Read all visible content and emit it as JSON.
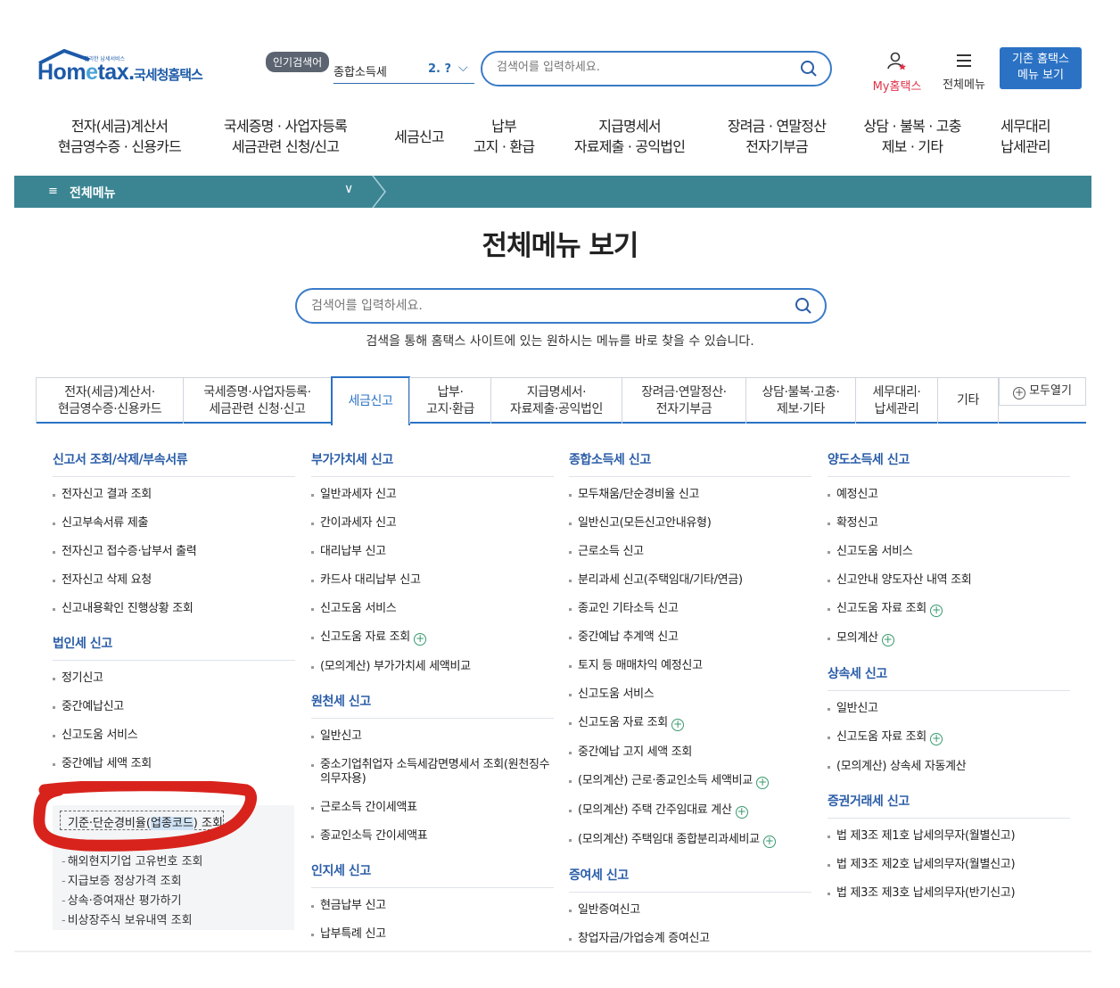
{
  "header": {
    "logo_small": "편리한 납세서비스",
    "logo_main_a": "Hom",
    "logo_main_e": "e",
    "logo_main_b": "tax.",
    "logo_kr": "국세청홈택스",
    "popular_badge": "인기검색어",
    "popular_item": "종합소득세",
    "popular_rank": "2. ?",
    "search_placeholder": "검색어를 입력하세요.",
    "my_hometax": "My홈택스",
    "all_menu": "전체메뉴",
    "legacy_line1": "기존 홈택스",
    "legacy_line2": "메뉴 보기"
  },
  "gnb": [
    {
      "l1": "전자(세금)계산서",
      "l2": "현금영수증 · 신용카드"
    },
    {
      "l1": "국세증명 · 사업자등록",
      "l2": "세금관련 신청/신고"
    },
    {
      "l1": "세금신고",
      "l2": ""
    },
    {
      "l1": "납부",
      "l2": "고지 · 환급"
    },
    {
      "l1": "지급명세서",
      "l2": "자료제출 · 공익법인"
    },
    {
      "l1": "장려금 · 연말정산",
      "l2": "전자기부금"
    },
    {
      "l1": "상담 · 불복 · 고충",
      "l2": "제보 · 기타"
    },
    {
      "l1": "세무대리",
      "l2": "납세관리"
    }
  ],
  "breadcrumb": {
    "label": "전체메뉴"
  },
  "page_title": "전체메뉴 보기",
  "main_search": {
    "placeholder": "검색어를 입력하세요.",
    "help": "검색을 통해 홈택스 사이트에 있는 원하시는 메뉴를 바로 찾을 수 있습니다."
  },
  "tabs": [
    {
      "l1": "전자(세금)계산서·",
      "l2": "현금영수증·신용카드"
    },
    {
      "l1": "국세증명·사업자등록·",
      "l2": "세금관련 신청·신고"
    },
    {
      "l1": "세금신고",
      "l2": "",
      "active": true
    },
    {
      "l1": "납부·",
      "l2": "고지·환급"
    },
    {
      "l1": "지급명세서·",
      "l2": "자료제출·공익법인"
    },
    {
      "l1": "장려금·연말정산·",
      "l2": "전자기부금"
    },
    {
      "l1": "상담·불복·고충·",
      "l2": "제보·기타"
    },
    {
      "l1": "세무대리·",
      "l2": "납세관리"
    },
    {
      "l1": "기타",
      "l2": ""
    }
  ],
  "expand_all": "모두열기",
  "columns": {
    "col1": {
      "s1_title": "신고서 조회/삭제/부속서류",
      "s1_items": [
        "전자신고 결과 조회",
        "신고부속서류 제출",
        "전자신고 접수증·납부서 출력",
        "전자신고 삭제 요청",
        "신고내용확인 진행상황 조회"
      ],
      "s2_title": "법인세 신고",
      "s2_items": [
        "정기신고",
        "중간예납신고",
        "신고도움 서비스",
        "중간예납 세액 조회"
      ],
      "sub_highlight_a": "기준·단순경비율(",
      "sub_highlight_b": "업종코드",
      "sub_highlight_c": ") 조회",
      "sub_items": [
        "해외현지기업 고유번호 조회",
        "지급보증 정상가격 조회",
        "상속·증여재산 평가하기",
        "비상장주식 보유내역 조회"
      ]
    },
    "col2": {
      "s1_title": "부가가치세 신고",
      "s1_items": [
        "일반과세자 신고",
        "간이과세자 신고",
        "대리납부 신고",
        "카드사 대리납부 신고",
        "신고도움 서비스",
        "신고도움 자료 조회",
        "(모의계산) 부가가치세 세액비교"
      ],
      "s2_title": "원천세 신고",
      "s2_items": [
        "일반신고",
        "중소기업취업자 소득세감면명세서 조회(원천징수의무자용)",
        "근로소득 간이세액표",
        "종교인소득 간이세액표"
      ],
      "s3_title": "인지세 신고",
      "s3_items": [
        "현금납부 신고",
        "납부특례 신고"
      ]
    },
    "col3": {
      "s1_title": "종합소득세 신고",
      "s1_items": [
        "모두채움/단순경비율 신고",
        "일반신고(모든신고안내유형)",
        "근로소득 신고",
        "분리과세 신고(주택임대/기타/연금)",
        "종교인 기타소득 신고",
        "중간예납 추계액 신고",
        "토지 등 매매차익 예정신고",
        "신고도움 서비스",
        "신고도움 자료 조회",
        "중간예납 고지 세액 조회",
        "(모의계산) 근로·종교인소득 세액비교",
        "(모의계산) 주택 간주임대료 계산",
        "(모의계산) 주택임대 종합분리과세비교"
      ],
      "s2_title": "증여세 신고",
      "s2_items": [
        "일반증여신고",
        "창업자금/가업승계 증여신고"
      ]
    },
    "col4": {
      "s1_title": "양도소득세 신고",
      "s1_items": [
        "예정신고",
        "확정신고",
        "신고도움 서비스",
        "신고안내 양도자산 내역 조회",
        "신고도움 자료 조회",
        "모의계산"
      ],
      "s2_title": "상속세 신고",
      "s2_items": [
        "일반신고",
        "신고도움 자료 조회",
        "(모의계산) 상속세 자동계산"
      ],
      "s3_title": "증권거래세 신고",
      "s3_items": [
        "법 제3조 제1호 납세의무자(월별신고)",
        "법 제3조 제2호 납세의무자(월별신고)",
        "법 제3조 제3호 납세의무자(반기신고)"
      ]
    }
  },
  "colors": {
    "brand": "#1d5aa8",
    "accent": "#2b72c4",
    "crumb_bar": "#3b8593",
    "marker": "#d8231c"
  }
}
